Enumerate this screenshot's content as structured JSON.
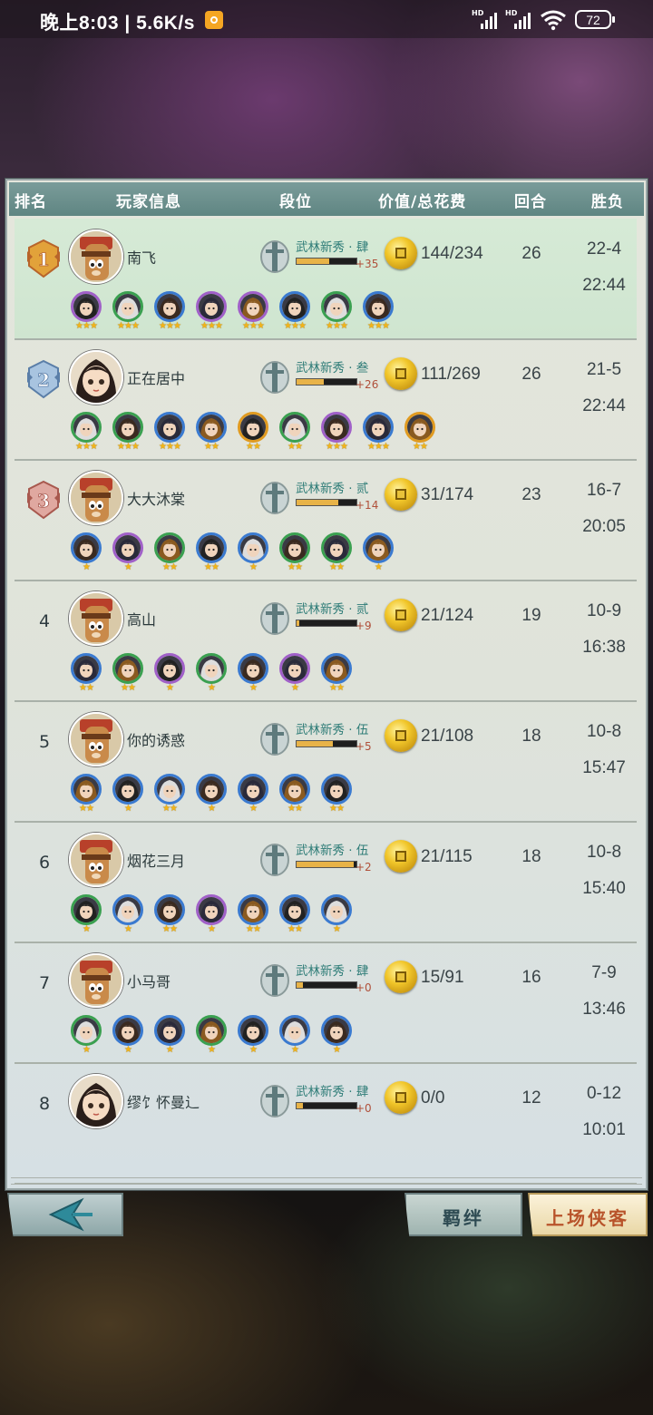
{
  "status_bar": {
    "time": "晚上8:03 | 5.6K/s",
    "signal1_label": "HD",
    "signal2_label": "HD",
    "battery": "72"
  },
  "table": {
    "headers": {
      "rank": "排名",
      "player": "玩家信息",
      "tier": "段位",
      "value": "价值/总花费",
      "rounds": "回合",
      "winloss": "胜负"
    },
    "rows": [
      {
        "rank": "1",
        "medal": "gold",
        "avatar": "red-monkey",
        "name": "南飞",
        "tier": "武林新秀 · 肆",
        "tier_progress": 0.55,
        "points": "+35",
        "value": "144/234",
        "rounds": "26",
        "wl": "22-4",
        "time": "22:44",
        "heroes": [
          {
            "frame": "#a060c8",
            "stars": "★★★"
          },
          {
            "frame": "#3aa050",
            "stars": "★★★"
          },
          {
            "frame": "#3a7ad0",
            "stars": "★★★"
          },
          {
            "frame": "#a060c8",
            "stars": "★★★"
          },
          {
            "frame": "#a060c8",
            "stars": "★★★"
          },
          {
            "frame": "#3a7ad0",
            "stars": "★★★"
          },
          {
            "frame": "#3aa050",
            "stars": "★★★"
          },
          {
            "frame": "#3a7ad0",
            "stars": "★★★"
          }
        ]
      },
      {
        "rank": "2",
        "medal": "silver",
        "avatar": "girl",
        "name": "正在居中",
        "tier": "武林新秀 · 叁",
        "tier_progress": 0.45,
        "points": "+26",
        "value": "111/269",
        "rounds": "26",
        "wl": "21-5",
        "time": "22:44",
        "heroes": [
          {
            "frame": "#3aa050",
            "stars": "★★★"
          },
          {
            "frame": "#3aa050",
            "stars": "★★★"
          },
          {
            "frame": "#3a7ad0",
            "stars": "★★★"
          },
          {
            "frame": "#3a7ad0",
            "stars": "★★"
          },
          {
            "frame": "#e09a20",
            "stars": "★★"
          },
          {
            "frame": "#3aa050",
            "stars": "★★"
          },
          {
            "frame": "#a060c8",
            "stars": "★★★"
          },
          {
            "frame": "#3a7ad0",
            "stars": "★★★"
          },
          {
            "frame": "#e09a20",
            "stars": "★★"
          }
        ]
      },
      {
        "rank": "3",
        "medal": "bronze",
        "avatar": "red-monkey",
        "name": "大大沐棠",
        "tier": "武林新秀 · 贰",
        "tier_progress": 0.7,
        "points": "+14",
        "value": "31/174",
        "rounds": "23",
        "wl": "16-7",
        "time": "20:05",
        "heroes": [
          {
            "frame": "#3a7ad0",
            "stars": "★"
          },
          {
            "frame": "#a060c8",
            "stars": "★"
          },
          {
            "frame": "#3aa050",
            "stars": "★★"
          },
          {
            "frame": "#3a7ad0",
            "stars": "★★"
          },
          {
            "frame": "#3a7ad0",
            "stars": "★"
          },
          {
            "frame": "#3aa050",
            "stars": "★★"
          },
          {
            "frame": "#3aa050",
            "stars": "★★"
          },
          {
            "frame": "#3a7ad0",
            "stars": "★"
          }
        ]
      },
      {
        "rank": "4",
        "medal": "",
        "avatar": "red-monkey",
        "name": "高山",
        "tier": "武林新秀 · 贰",
        "tier_progress": 0.05,
        "points": "+9",
        "value": "21/124",
        "rounds": "19",
        "wl": "10-9",
        "time": "16:38",
        "heroes": [
          {
            "frame": "#3a7ad0",
            "stars": "★★"
          },
          {
            "frame": "#3aa050",
            "stars": "★★"
          },
          {
            "frame": "#a060c8",
            "stars": "★"
          },
          {
            "frame": "#3aa050",
            "stars": "★"
          },
          {
            "frame": "#3a7ad0",
            "stars": "★"
          },
          {
            "frame": "#a060c8",
            "stars": "★"
          },
          {
            "frame": "#3a7ad0",
            "stars": "★★"
          }
        ]
      },
      {
        "rank": "5",
        "medal": "",
        "avatar": "red-monkey",
        "name": "你的诱惑",
        "tier": "武林新秀 · 伍",
        "tier_progress": 0.6,
        "points": "+5",
        "value": "21/108",
        "rounds": "18",
        "wl": "10-8",
        "time": "15:47",
        "heroes": [
          {
            "frame": "#3a7ad0",
            "stars": "★★"
          },
          {
            "frame": "#3a7ad0",
            "stars": "★"
          },
          {
            "frame": "#3a7ad0",
            "stars": "★★"
          },
          {
            "frame": "#3a7ad0",
            "stars": "★"
          },
          {
            "frame": "#3a7ad0",
            "stars": "★"
          },
          {
            "frame": "#3a7ad0",
            "stars": "★★"
          },
          {
            "frame": "#3a7ad0",
            "stars": "★★"
          }
        ]
      },
      {
        "rank": "6",
        "medal": "",
        "avatar": "red-monkey",
        "name": "烟花三月",
        "tier": "武林新秀 · 伍",
        "tier_progress": 0.95,
        "points": "+2",
        "value": "21/115",
        "rounds": "18",
        "wl": "10-8",
        "time": "15:40",
        "heroes": [
          {
            "frame": "#3aa050",
            "stars": "★"
          },
          {
            "frame": "#3a7ad0",
            "stars": "★"
          },
          {
            "frame": "#3a7ad0",
            "stars": "★★"
          },
          {
            "frame": "#a060c8",
            "stars": "★"
          },
          {
            "frame": "#3a7ad0",
            "stars": "★★"
          },
          {
            "frame": "#3a7ad0",
            "stars": "★★"
          },
          {
            "frame": "#3a7ad0",
            "stars": "★"
          }
        ]
      },
      {
        "rank": "7",
        "medal": "",
        "avatar": "red-monkey",
        "name": "小马哥",
        "tier": "武林新秀 · 肆",
        "tier_progress": 0.1,
        "points": "+0",
        "value": "15/91",
        "rounds": "16",
        "wl": "7-9",
        "time": "13:46",
        "heroes": [
          {
            "frame": "#3aa050",
            "stars": "★"
          },
          {
            "frame": "#3a7ad0",
            "stars": "★"
          },
          {
            "frame": "#3a7ad0",
            "stars": "★"
          },
          {
            "frame": "#3aa050",
            "stars": "★"
          },
          {
            "frame": "#3a7ad0",
            "stars": "★"
          },
          {
            "frame": "#3a7ad0",
            "stars": "★"
          },
          {
            "frame": "#3a7ad0",
            "stars": "★"
          }
        ]
      },
      {
        "rank": "8",
        "medal": "",
        "avatar": "girl",
        "name": "缪饣怀曼辶",
        "tier": "武林新秀 · 肆",
        "tier_progress": 0.1,
        "points": "+0",
        "value": "0/0",
        "rounds": "12",
        "wl": "0-12",
        "time": "10:01",
        "heroes": []
      }
    ]
  },
  "buttons": {
    "back_icon": "back-arrow-icon",
    "bond": "羁绊",
    "deploy": "上场侠客"
  },
  "colors": {
    "header_bg": "#6a8e8b",
    "first_row_bg": "#d2e7d2",
    "tier_text": "#2e7c77",
    "points_text": "#b0503a",
    "star": "#f2b418"
  }
}
